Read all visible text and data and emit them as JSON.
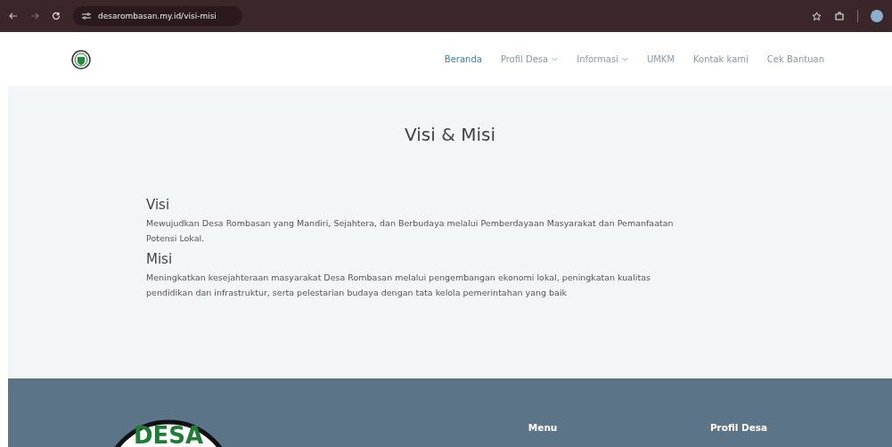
{
  "browser": {
    "url": "desarombasan.my.id/visi-misi"
  },
  "nav": {
    "items": [
      {
        "label": "Beranda",
        "selected": true,
        "dropdown": false
      },
      {
        "label": "Profil Desa",
        "selected": false,
        "dropdown": true
      },
      {
        "label": "Informasi",
        "selected": false,
        "dropdown": true
      },
      {
        "label": "UMKM",
        "selected": false,
        "dropdown": false
      },
      {
        "label": "Kontak kami",
        "selected": false,
        "dropdown": false
      },
      {
        "label": "Cek Bantuan",
        "selected": false,
        "dropdown": false
      }
    ]
  },
  "page": {
    "title": "Visi & Misi",
    "sections": [
      {
        "heading": "Visi",
        "text": "Mewujudkan Desa Rombasan yang Mandiri, Sejahtera, dan Berbudaya melalui Pemberdayaan Masyarakat dan Pemanfaatan Potensi Lokal."
      },
      {
        "heading": "Misi",
        "text": "Meningkatkan kesejahteraan masyarakat Desa Rombasan melalui pengembangan ekonomi lokal, peningkatan kualitas pendidikan dan infrastruktur, serta pelestarian budaya dengan tata kelola pemerintahan yang baik"
      }
    ]
  },
  "footer": {
    "logo_text": "DESA",
    "columns": [
      {
        "heading": "Menu"
      },
      {
        "heading": "Profil Desa"
      }
    ]
  }
}
